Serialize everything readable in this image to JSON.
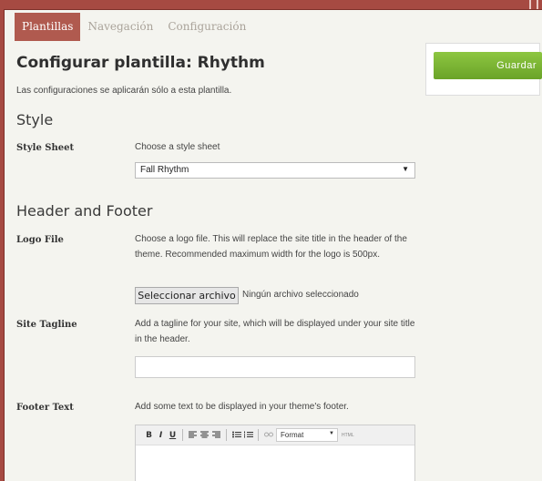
{
  "tabs": [
    {
      "label": "Plantillas",
      "active": true
    },
    {
      "label": "Navegación",
      "active": false
    },
    {
      "label": "Configuración",
      "active": false
    }
  ],
  "page_title": "Configurar plantilla: Rhythm",
  "intro": "Las configuraciones se aplicarán sólo a esta plantilla.",
  "sections": {
    "style": "Style",
    "header_footer": "Header and Footer"
  },
  "style_sheet": {
    "label": "Style Sheet",
    "desc": "Choose a style sheet",
    "selected": "Fall Rhythm"
  },
  "logo_file": {
    "label": "Logo File",
    "desc": "Choose a logo file. This will replace the site title in the header of the theme. Recommended maximum width for the logo is 500px.",
    "button": "Seleccionar archivo",
    "status": "Ningún archivo seleccionado"
  },
  "site_tagline": {
    "label": "Site Tagline",
    "desc": "Add a tagline for your site, which will be displayed under your site title in the header.",
    "value": ""
  },
  "footer_text": {
    "label": "Footer Text",
    "desc": "Add some text to be displayed in your theme's footer."
  },
  "editor_toolbar": {
    "bold": "B",
    "italic": "I",
    "underline": "U",
    "format_label": "Format",
    "html_label": "HTML"
  },
  "save_button": "Guardar",
  "colors": {
    "border": "#a64a42",
    "active_tab": "#b05a4f",
    "save_green": "#7ab535"
  }
}
